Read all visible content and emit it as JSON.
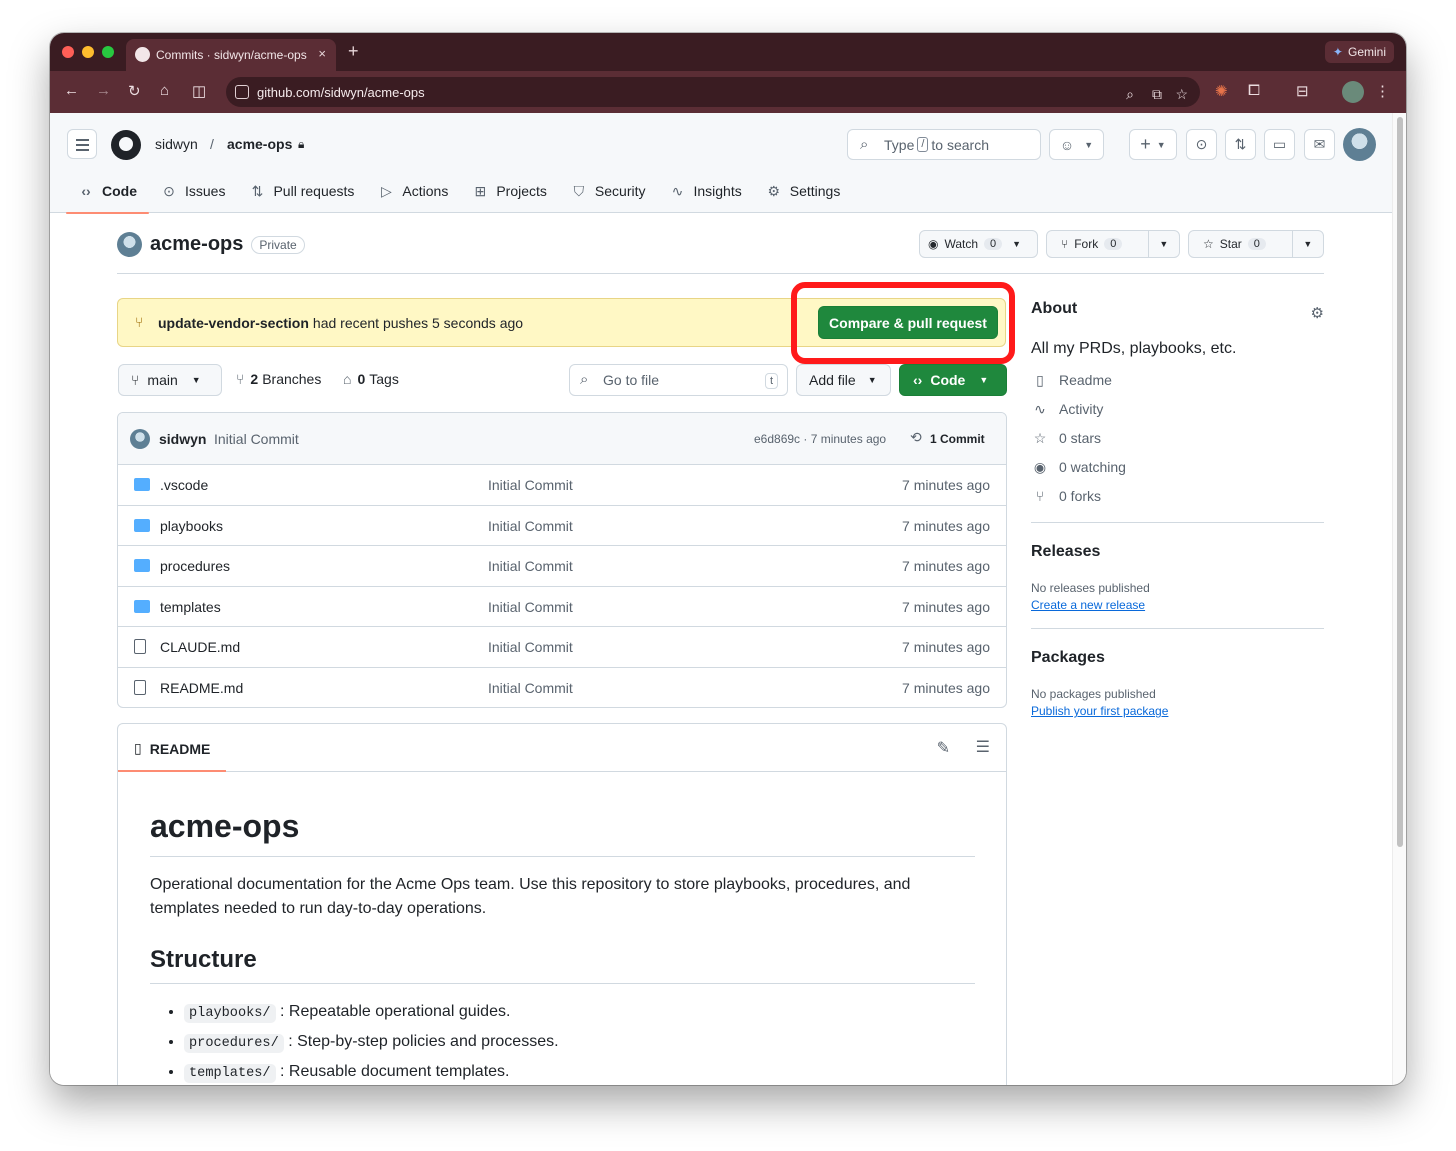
{
  "browser": {
    "tab_title": "Commits · sidwyn/acme-ops",
    "tab_close": "×",
    "new_tab": "+",
    "gemini_label": "Gemini",
    "url": "github.com/sidwyn/acme-ops"
  },
  "header": {
    "owner": "sidwyn",
    "separator": "/",
    "repo": "acme-ops",
    "search_prefix": "Type",
    "search_key": "/",
    "search_suffix": "to search"
  },
  "repo_nav": [
    {
      "label": "Code",
      "icon": "code-icon"
    },
    {
      "label": "Issues",
      "icon": "issue-icon"
    },
    {
      "label": "Pull requests",
      "icon": "pull-request-icon"
    },
    {
      "label": "Actions",
      "icon": "play-icon"
    },
    {
      "label": "Projects",
      "icon": "table-icon"
    },
    {
      "label": "Security",
      "icon": "shield-icon"
    },
    {
      "label": "Insights",
      "icon": "graph-icon"
    },
    {
      "label": "Settings",
      "icon": "gear-icon"
    }
  ],
  "repo": {
    "name": "acme-ops",
    "visibility": "Private",
    "watch_label": "Watch",
    "watch_count": "0",
    "fork_label": "Fork",
    "fork_count": "0",
    "star_label": "Star",
    "star_count": "0"
  },
  "banner": {
    "branch": "update-vendor-section",
    "text": "had recent pushes 5 seconds ago",
    "button": "Compare & pull request"
  },
  "branchbar": {
    "branch": "main",
    "branches_count": "2",
    "branches_label": "Branches",
    "tags_count": "0",
    "tags_label": "Tags",
    "goto_placeholder": "Go to file",
    "goto_key": "t",
    "add_file": "Add file",
    "code": "Code"
  },
  "latest_commit": {
    "author": "sidwyn",
    "message": "Initial Commit",
    "meta": "e6d869c · 7 minutes ago",
    "count": "1 Commit"
  },
  "files": [
    {
      "name": ".vscode",
      "type": "folder",
      "message": "Initial Commit",
      "age": "7 minutes ago"
    },
    {
      "name": "playbooks",
      "type": "folder",
      "message": "Initial Commit",
      "age": "7 minutes ago"
    },
    {
      "name": "procedures",
      "type": "folder",
      "message": "Initial Commit",
      "age": "7 minutes ago"
    },
    {
      "name": "templates",
      "type": "folder",
      "message": "Initial Commit",
      "age": "7 minutes ago"
    },
    {
      "name": "CLAUDE.md",
      "type": "file",
      "message": "Initial Commit",
      "age": "7 minutes ago"
    },
    {
      "name": "README.md",
      "type": "file",
      "message": "Initial Commit",
      "age": "7 minutes ago"
    }
  ],
  "readme": {
    "tab": "README",
    "h1": "acme-ops",
    "intro": "Operational documentation for the Acme Ops team. Use this repository to store playbooks, procedures, and templates needed to run day-to-day operations.",
    "h2": "Structure",
    "items": [
      {
        "code": "playbooks/",
        "text": ": Repeatable operational guides."
      },
      {
        "code": "procedures/",
        "text": ": Step-by-step policies and processes."
      },
      {
        "code": "templates/",
        "text": ": Reusable document templates."
      }
    ]
  },
  "about": {
    "title": "About",
    "description": "All my PRDs, playbooks, etc.",
    "links": [
      {
        "icon": "book-icon",
        "label": "Readme"
      },
      {
        "icon": "pulse-icon",
        "label": "Activity"
      },
      {
        "icon": "star-icon",
        "label": "0 stars"
      },
      {
        "icon": "eye-icon",
        "label": "0 watching"
      },
      {
        "icon": "fork-icon",
        "label": "0 forks"
      }
    ],
    "releases_title": "Releases",
    "releases_none": "No releases published",
    "releases_link": "Create a new release",
    "packages_title": "Packages",
    "packages_none": "No packages published",
    "packages_link": "Publish your first package"
  },
  "colors": {
    "primary_button": "#1f883d",
    "highlight_box": "#ff1a1a",
    "banner_bg": "#fff8c5",
    "active_tab_underline": "#fd8c73"
  }
}
